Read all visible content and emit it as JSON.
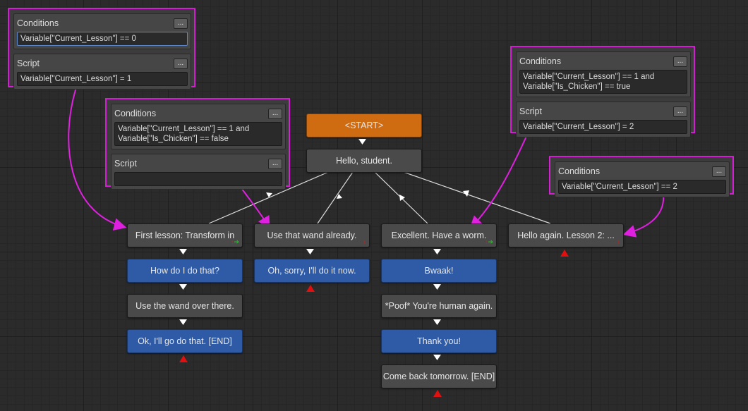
{
  "colors": {
    "link": "#dcdcdc",
    "annotation": "#d21fd2",
    "npc": "#4a4a4a",
    "pc": "#2f5aa5",
    "start": "#cf6c12",
    "end_marker": "#e01010"
  },
  "nodes": {
    "start": "<START>",
    "hello": "Hello, student.",
    "first_lesson": "First lesson: Transform in",
    "how_do_i": "How do I do that?",
    "use_wand_over": "Use the wand over there.",
    "ok_go": "Ok, I'll go do that. [END]",
    "use_wand_already": "Use that wand already.",
    "oh_sorry": "Oh, sorry, I'll do it now.",
    "excellent": "Excellent. Have a worm.",
    "bwaak": "Bwaak!",
    "poof": "*Poof* You're human again.",
    "thank_you": "Thank you!",
    "come_back": "Come back tomorrow. [END]",
    "hello_again": "Hello again. Lesson 2: ..."
  },
  "panels": {
    "p1": {
      "conditions_label": "Conditions",
      "conditions": "Variable[\"Current_Lesson\"] == 0",
      "script_label": "Script",
      "script": "Variable[\"Current_Lesson\"] = 1",
      "more": "..."
    },
    "p2": {
      "conditions_label": "Conditions",
      "conditions": "Variable[\"Current_Lesson\"] == 1 and\nVariable[\"Is_Chicken\"] == false",
      "script_label": "Script",
      "script": "",
      "more": "..."
    },
    "p3": {
      "conditions_label": "Conditions",
      "conditions": "Variable[\"Current_Lesson\"] == 1 and\nVariable[\"Is_Chicken\"] == true",
      "script_label": "Script",
      "script": "Variable[\"Current_Lesson\"] = 2",
      "more": "..."
    },
    "p4": {
      "conditions_label": "Conditions",
      "conditions": "Variable[\"Current_Lesson\"] == 2",
      "more": "..."
    }
  }
}
